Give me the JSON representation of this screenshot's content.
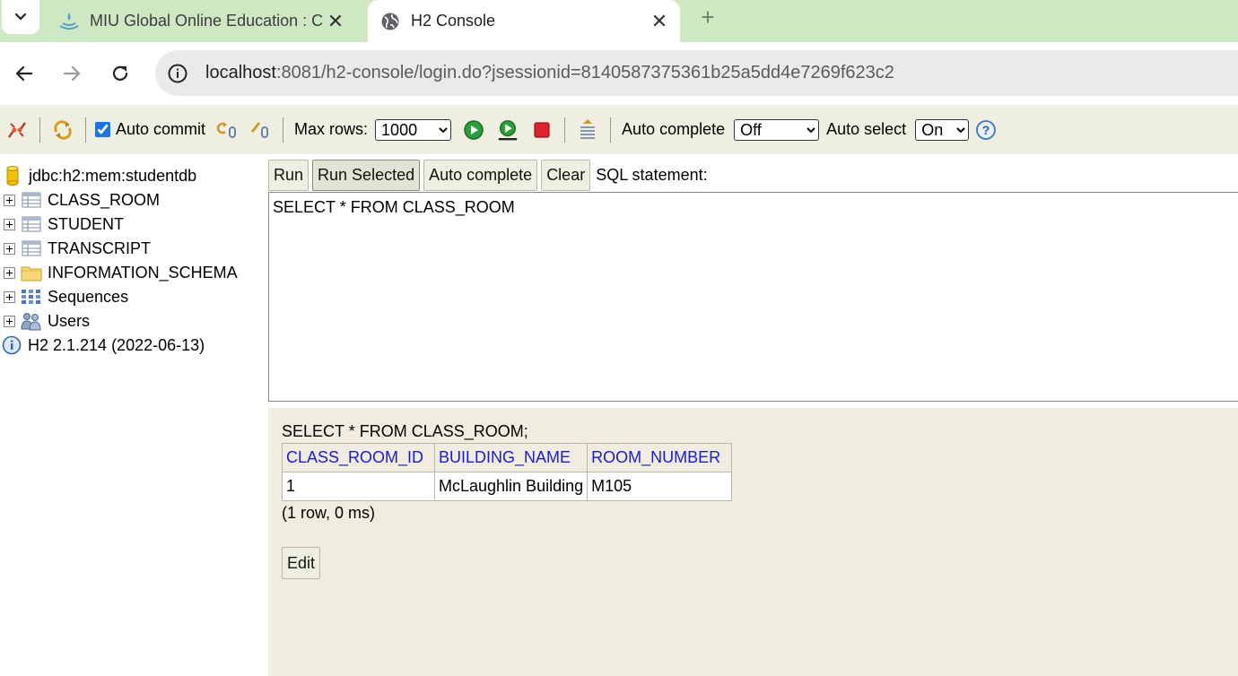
{
  "browser": {
    "tabs": [
      {
        "title": "MIU Global Online Education : C",
        "active": false,
        "icon": "miu-logo-icon"
      },
      {
        "title": "H2 Console",
        "active": true,
        "icon": "globe-icon"
      }
    ],
    "url_host": "localhost",
    "url_rest": ":8081/h2-console/login.do?jsessionid=8140587375361b25a5dd4e7269f623c2"
  },
  "toolbar": {
    "auto_commit_label": "Auto commit",
    "auto_commit_checked": true,
    "max_rows_label": "Max rows:",
    "max_rows_value": "1000",
    "auto_complete_label": "Auto complete",
    "auto_complete_value": "Off",
    "auto_select_label": "Auto select",
    "auto_select_value": "On"
  },
  "tree": {
    "connection": "jdbc:h2:mem:studentdb",
    "items": [
      {
        "label": "CLASS_ROOM",
        "icon": "table-icon"
      },
      {
        "label": "STUDENT",
        "icon": "table-icon"
      },
      {
        "label": "TRANSCRIPT",
        "icon": "table-icon"
      },
      {
        "label": "INFORMATION_SCHEMA",
        "icon": "folder-icon"
      },
      {
        "label": "Sequences",
        "icon": "sequences-icon"
      },
      {
        "label": "Users",
        "icon": "users-icon"
      }
    ],
    "version": "H2 2.1.214 (2022-06-13)"
  },
  "query": {
    "buttons": {
      "run": "Run",
      "run_selected": "Run Selected",
      "auto_complete": "Auto complete",
      "clear": "Clear"
    },
    "sql_label": "SQL statement:",
    "sql_text": "SELECT * FROM CLASS_ROOM"
  },
  "result": {
    "statement": "SELECT * FROM CLASS_ROOM;",
    "columns": [
      "CLASS_ROOM_ID",
      "BUILDING_NAME",
      "ROOM_NUMBER"
    ],
    "rows": [
      [
        "1",
        "McLaughlin Building",
        "M105"
      ]
    ],
    "row_count": "(1 row, 0 ms)",
    "edit_label": "Edit"
  },
  "colors": {
    "tabstrip_bg": "#cfe8c4",
    "h2_toolbar_bg": "#efefe1",
    "result_bg": "#f0ede0",
    "column_header": "#1a1adc"
  }
}
